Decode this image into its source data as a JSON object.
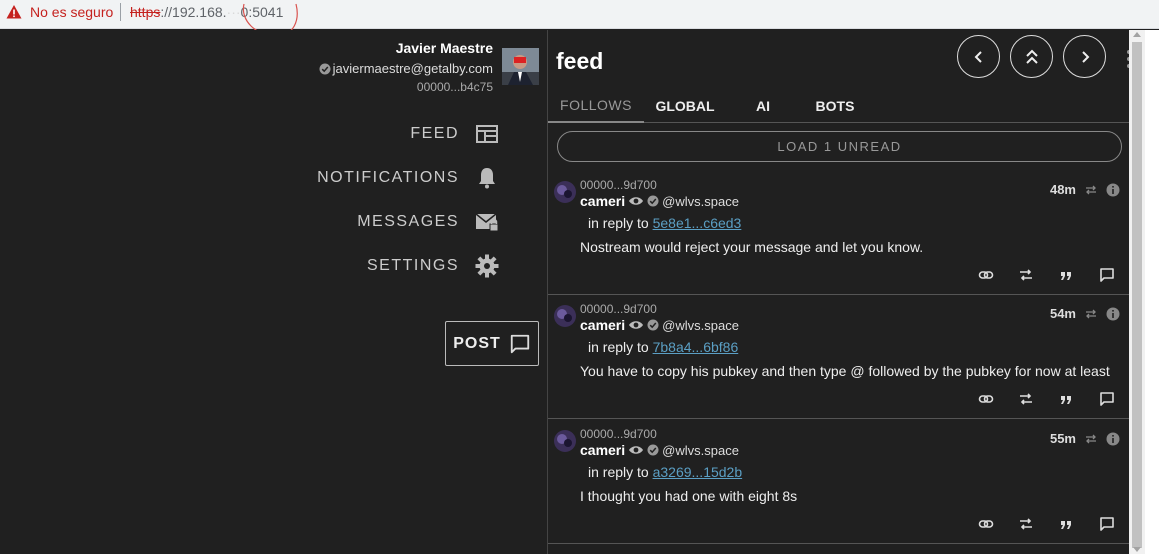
{
  "browser": {
    "security_warning": "No es seguro",
    "url_scheme": "https",
    "url_rest": "://192.168.",
    "url_port": "0:5041"
  },
  "profile": {
    "name": "Javier Maestre",
    "email": "javiermaestre@getalby.com",
    "pubkey_short": "00000...b4c75"
  },
  "nav": [
    {
      "label": "FEED",
      "icon": "feed-icon"
    },
    {
      "label": "NOTIFICATIONS",
      "icon": "bell-icon"
    },
    {
      "label": "MESSAGES",
      "icon": "mail-lock-icon"
    },
    {
      "label": "SETTINGS",
      "icon": "gear-icon"
    }
  ],
  "post_button": {
    "label": "POST",
    "icon": "chat-icon"
  },
  "feed": {
    "title": "feed",
    "tabs": [
      "FOLLOWS",
      "GLOBAL",
      "AI",
      "BOTS"
    ],
    "active_tab": "FOLLOWS",
    "load_unread": "LOAD 1 UNREAD",
    "reply_prefix": "in reply to",
    "posts": [
      {
        "pubkey": "00000...9d700",
        "author": "cameri",
        "nip05": "@wlvs.space",
        "reply_to": "5e8e1...c6ed3",
        "text": "Nostream would reject your message and let you know.",
        "time": "48m"
      },
      {
        "pubkey": "00000...9d700",
        "author": "cameri",
        "nip05": "@wlvs.space",
        "reply_to": "7b8a4...6bf86",
        "text": "You have to copy his pubkey and then type @ followed by the pubkey for now at least",
        "time": "54m"
      },
      {
        "pubkey": "00000...9d700",
        "author": "cameri",
        "nip05": "@wlvs.space",
        "reply_to": "a3269...15d2b",
        "text": "I thought you had one with eight 8s",
        "time": "55m"
      }
    ]
  },
  "colors": {
    "background": "#202020",
    "link": "#5b9fc4",
    "warning": "#c5221f"
  }
}
